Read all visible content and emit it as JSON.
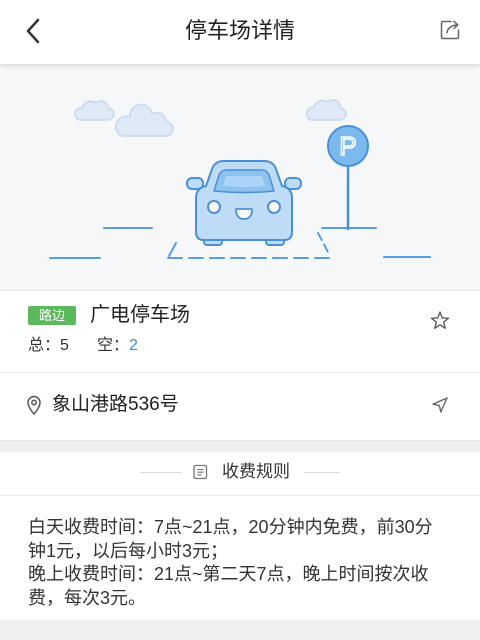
{
  "header": {
    "title": "停车场详情",
    "back_icon": "chevron-left-icon",
    "share_icon": "share-icon"
  },
  "illustration": {
    "sign_letter": "P"
  },
  "lot": {
    "badge": "路边",
    "name": "广电停车场",
    "favorite_icon": "star-outline-icon",
    "total_label": "总：",
    "total": "5",
    "free_label": "空：",
    "free": "2"
  },
  "address": {
    "icon": "location-pin-icon",
    "text": "象山港路536号",
    "nav_icon": "navigation-arrow-icon"
  },
  "fees": {
    "icon": "document-list-icon",
    "title": "收费规则",
    "lines": [
      "白天收费时间：7点~21点，20分钟内免费，前30分钟1元，以后每小时3元；",
      "晚上收费时间：21点~第二天7点，晚上时间按次收费，每次3元。"
    ]
  },
  "colors": {
    "badge_green": "#5cb85c",
    "accent_blue": "#3a8ee6",
    "illustration_blue": "#4a90d9",
    "separator_gray": "#efeff1"
  }
}
